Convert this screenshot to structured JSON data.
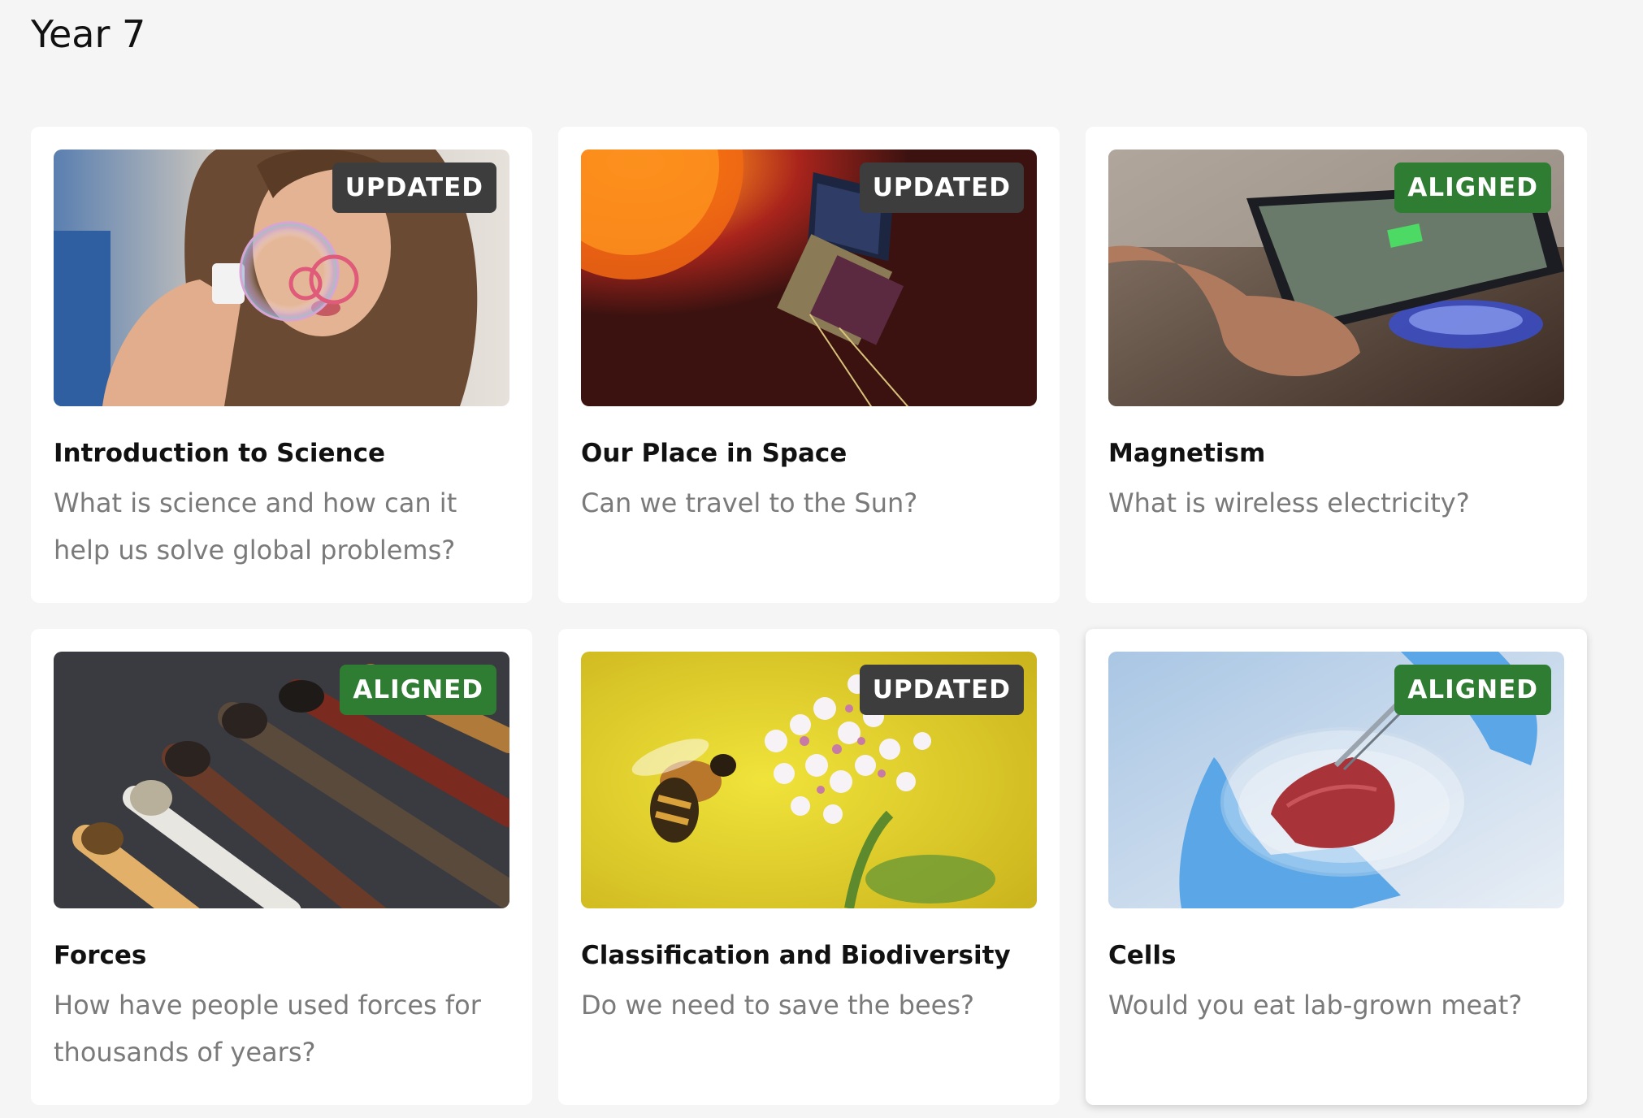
{
  "page": {
    "title": "Year 7"
  },
  "colors": {
    "updated_badge": "#3d3d3d",
    "aligned_badge": "#2f7d32",
    "background": "#f5f5f5",
    "card": "#ffffff"
  },
  "cards": [
    {
      "title": "Introduction to Science",
      "subtitle": "What is science and how can it help us solve global problems?",
      "badge": "UPDATED",
      "image": "girl-blowing-bubble-image"
    },
    {
      "title": "Our Place in Space",
      "subtitle": "Can we travel to the Sun?",
      "badge": "UPDATED",
      "image": "solar-probe-image"
    },
    {
      "title": "Magnetism",
      "subtitle": "What is wireless electricity?",
      "badge": "ALIGNED",
      "image": "wireless-charging-phone-image"
    },
    {
      "title": "Forces",
      "subtitle": "How have people used forces for thousands of years?",
      "badge": "ALIGNED",
      "image": "matches-image"
    },
    {
      "title": "Classification and Biodiversity",
      "subtitle": "Do we need to save the bees?",
      "badge": "UPDATED",
      "image": "bee-on-flowers-image"
    },
    {
      "title": "Cells",
      "subtitle": "Would you eat lab-grown meat?",
      "badge": "ALIGNED",
      "image": "lab-grown-meat-image"
    }
  ]
}
